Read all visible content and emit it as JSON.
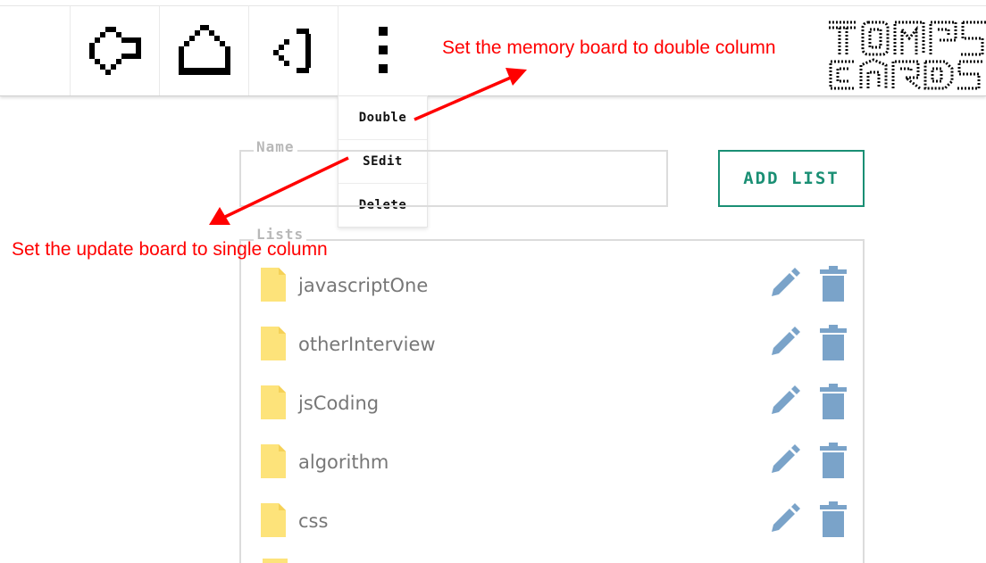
{
  "toolbar": {
    "buttons": [
      {
        "name": "back-arrow-icon"
      },
      {
        "name": "home-icon"
      },
      {
        "name": "logout-icon"
      },
      {
        "name": "more-vertical-icon"
      }
    ],
    "logo_text": "TOMPS CARDS"
  },
  "menu": {
    "items": [
      "Double",
      "SEdit",
      "Delete"
    ]
  },
  "form": {
    "name_legend": "Name",
    "name_value": "",
    "add_button": "ADD LIST",
    "lists_legend": "Lists"
  },
  "lists": [
    {
      "label": "javascriptOne"
    },
    {
      "label": "otherInterview"
    },
    {
      "label": "jsCoding"
    },
    {
      "label": "algorithm"
    },
    {
      "label": "css"
    }
  ],
  "annotations": {
    "top": "Set the memory board to double column",
    "left": "Set the update board to single column"
  },
  "colors": {
    "accent": "#1a8f74",
    "icon_blue": "#7aa3c9",
    "file_yellow": "#fde37a",
    "annotation_red": "#ff0000"
  }
}
